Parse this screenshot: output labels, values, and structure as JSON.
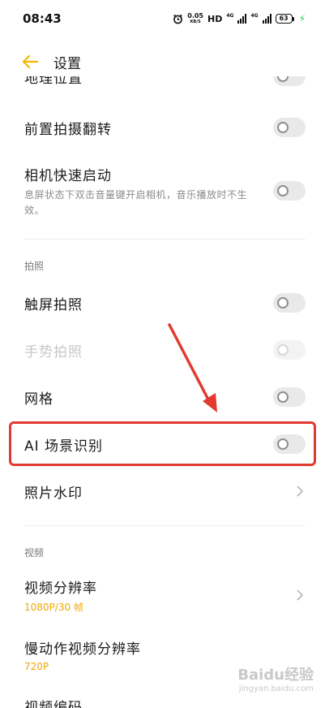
{
  "status_bar": {
    "time": "08:43",
    "net_speed_value": "0.05",
    "net_speed_unit": "KB/S",
    "hd_label": "HD",
    "net_type_1": "4G",
    "net_type_2": "4G",
    "battery_level": "63",
    "icons": [
      "alarm-icon",
      "signal-icon",
      "signal-icon",
      "battery-icon",
      "charging-bolt-icon"
    ]
  },
  "header": {
    "title": "设置",
    "back_icon": "back-arrow-icon",
    "accent_color": "#f5b800"
  },
  "partial_top_item": {
    "label": "地理位置",
    "toggle_on": false
  },
  "items": [
    {
      "label": "前置拍摄翻转",
      "type": "toggle",
      "on": false
    },
    {
      "label": "相机快速启动",
      "description": "息屏状态下双击音量键开启相机，音乐播放时不生效。",
      "type": "toggle",
      "on": false
    }
  ],
  "section_photo": {
    "title": "拍照",
    "items": [
      {
        "label": "触屏拍照",
        "type": "toggle",
        "on": false
      },
      {
        "label": "手势拍照",
        "type": "toggle",
        "on": false,
        "enabled": false
      },
      {
        "label": "网格",
        "type": "toggle",
        "on": false
      },
      {
        "label": "AI 场景识别",
        "type": "toggle",
        "on": false,
        "highlighted": true
      },
      {
        "label": "照片水印",
        "type": "link"
      }
    ]
  },
  "section_video": {
    "title": "视频",
    "items": [
      {
        "label": "视频分辨率",
        "value": "1080P/30 帧",
        "type": "link"
      },
      {
        "label": "慢动作视频分辨率",
        "value": "720P",
        "type": "link"
      },
      {
        "label": "视频编码",
        "type": "link"
      }
    ]
  },
  "annotation": {
    "color": "#e23a2e"
  },
  "watermark": {
    "main": "Baidu经验",
    "sub": "jingyan.baidu.com"
  }
}
